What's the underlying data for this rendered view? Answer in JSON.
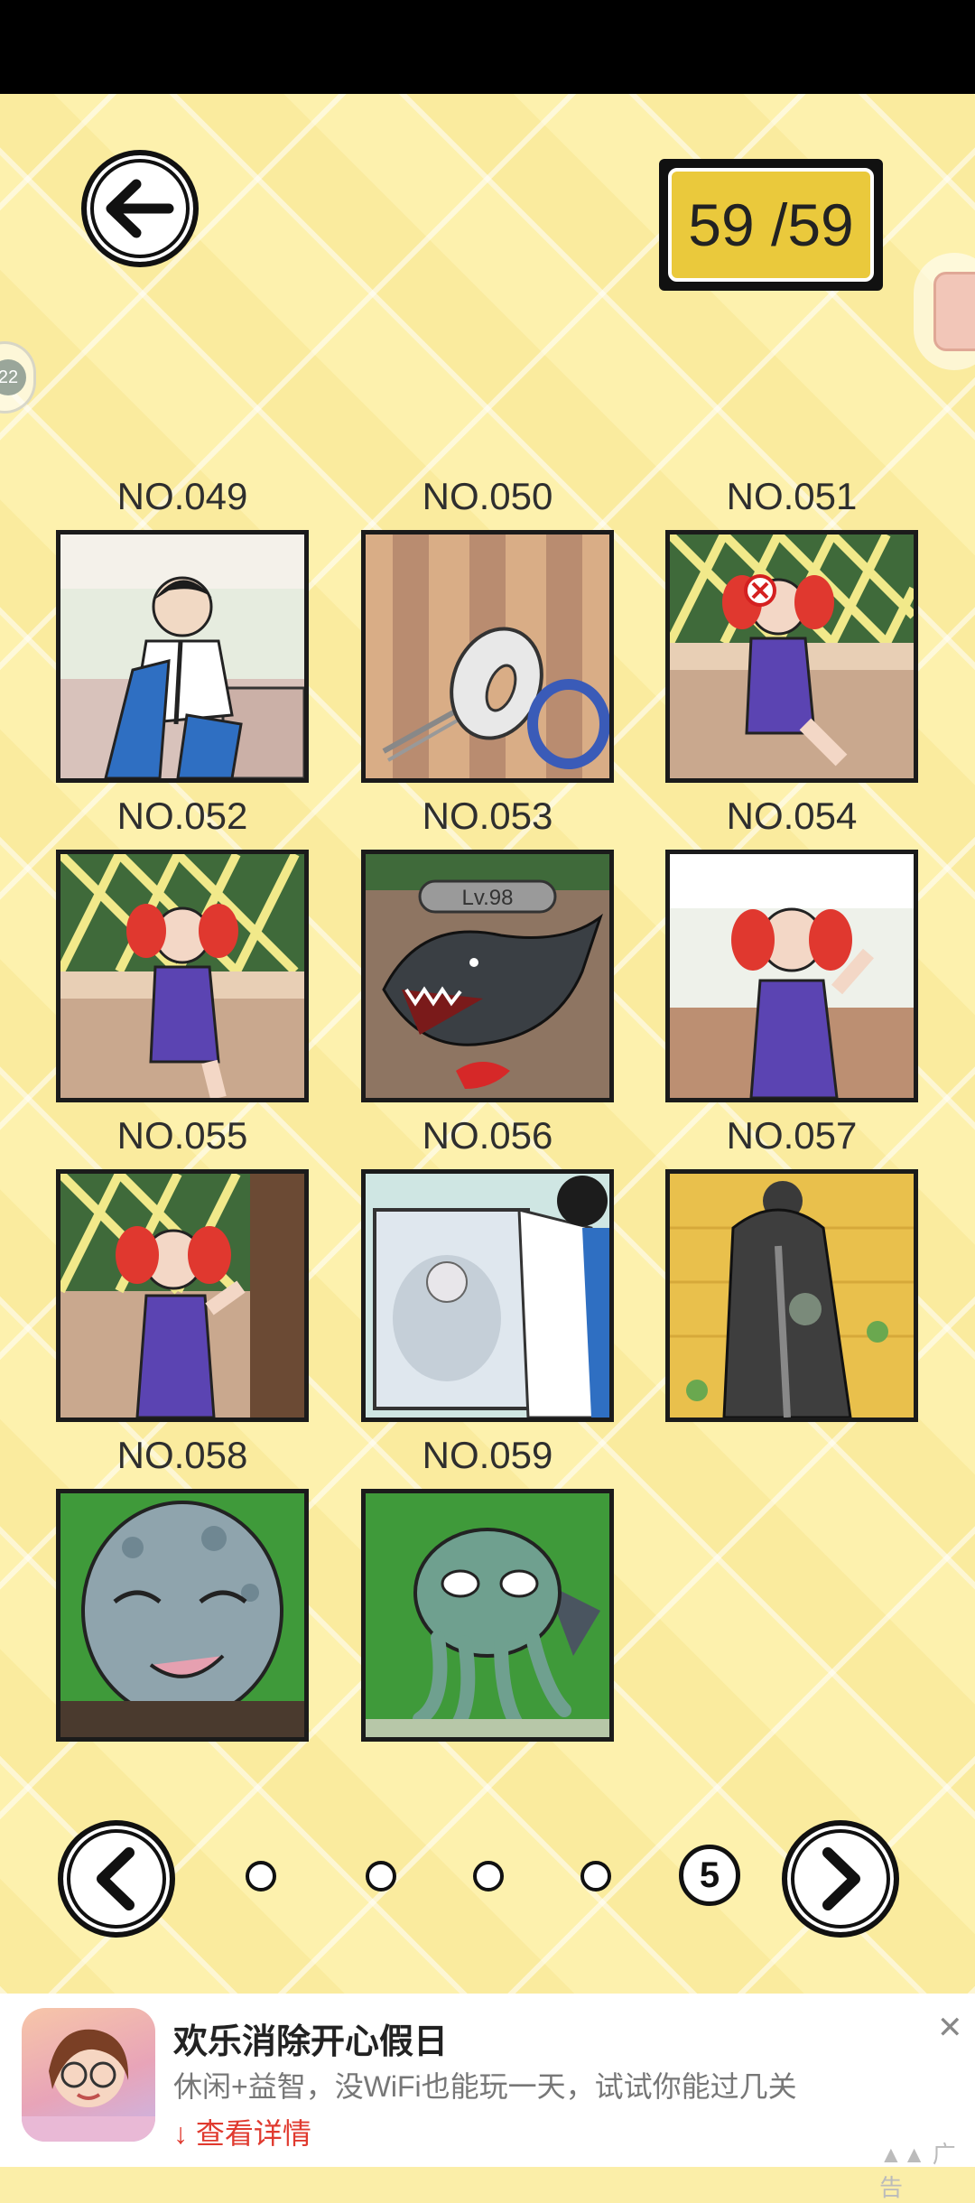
{
  "status_bar": {},
  "header": {
    "counter_text": "59 /59",
    "side_badge_left": "22"
  },
  "gallery": {
    "items": [
      {
        "label": "NO.049"
      },
      {
        "label": "NO.050"
      },
      {
        "label": "NO.051"
      },
      {
        "label": "NO.052"
      },
      {
        "label": "NO.053",
        "badge": "Lv.98"
      },
      {
        "label": "NO.054"
      },
      {
        "label": "NO.055"
      },
      {
        "label": "NO.056"
      },
      {
        "label": "NO.057"
      },
      {
        "label": "NO.058"
      },
      {
        "label": "NO.059"
      }
    ]
  },
  "pager": {
    "current_page": "5",
    "total_pages": 5
  },
  "ad": {
    "title": "欢乐消除开心假日",
    "subtitle": "休闲+益智，没WiFi也能玩一天，试试你能过几关",
    "link": "↓ 查看详情",
    "close": "✕",
    "tag": "▲▲ 广告"
  }
}
